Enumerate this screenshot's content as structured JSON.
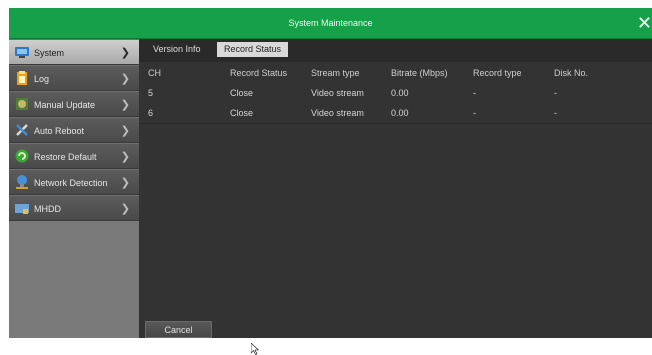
{
  "window": {
    "title": "System Maintenance"
  },
  "sidebar": {
    "items": [
      {
        "label": "System",
        "icon": "monitor-icon",
        "active": true
      },
      {
        "label": "Log",
        "icon": "clipboard-icon",
        "active": false
      },
      {
        "label": "Manual Update",
        "icon": "update-icon",
        "active": false
      },
      {
        "label": "Auto Reboot",
        "icon": "tools-icon",
        "active": false
      },
      {
        "label": "Restore Default",
        "icon": "restore-icon",
        "active": false
      },
      {
        "label": "Network Detection",
        "icon": "network-icon",
        "active": false
      },
      {
        "label": "MHDD",
        "icon": "disk-icon",
        "active": false
      }
    ]
  },
  "tabs": [
    {
      "label": "Version Info",
      "active": false
    },
    {
      "label": "Record Status",
      "active": true
    }
  ],
  "table": {
    "headers": [
      "CH",
      "Record Status",
      "Stream type",
      "Bitrate (Mbps)",
      "Record type",
      "Disk No."
    ],
    "rows": [
      [
        "5",
        "Close",
        "Video stream",
        "0.00",
        "-",
        "-"
      ],
      [
        "6",
        "Close",
        "Video stream",
        "0.00",
        "-",
        "-"
      ]
    ]
  },
  "footer": {
    "cancel_label": "Cancel"
  },
  "colors": {
    "titlebar": "#17a04a",
    "active_item": "#c0c0c0",
    "background": "#2a2a2a"
  }
}
